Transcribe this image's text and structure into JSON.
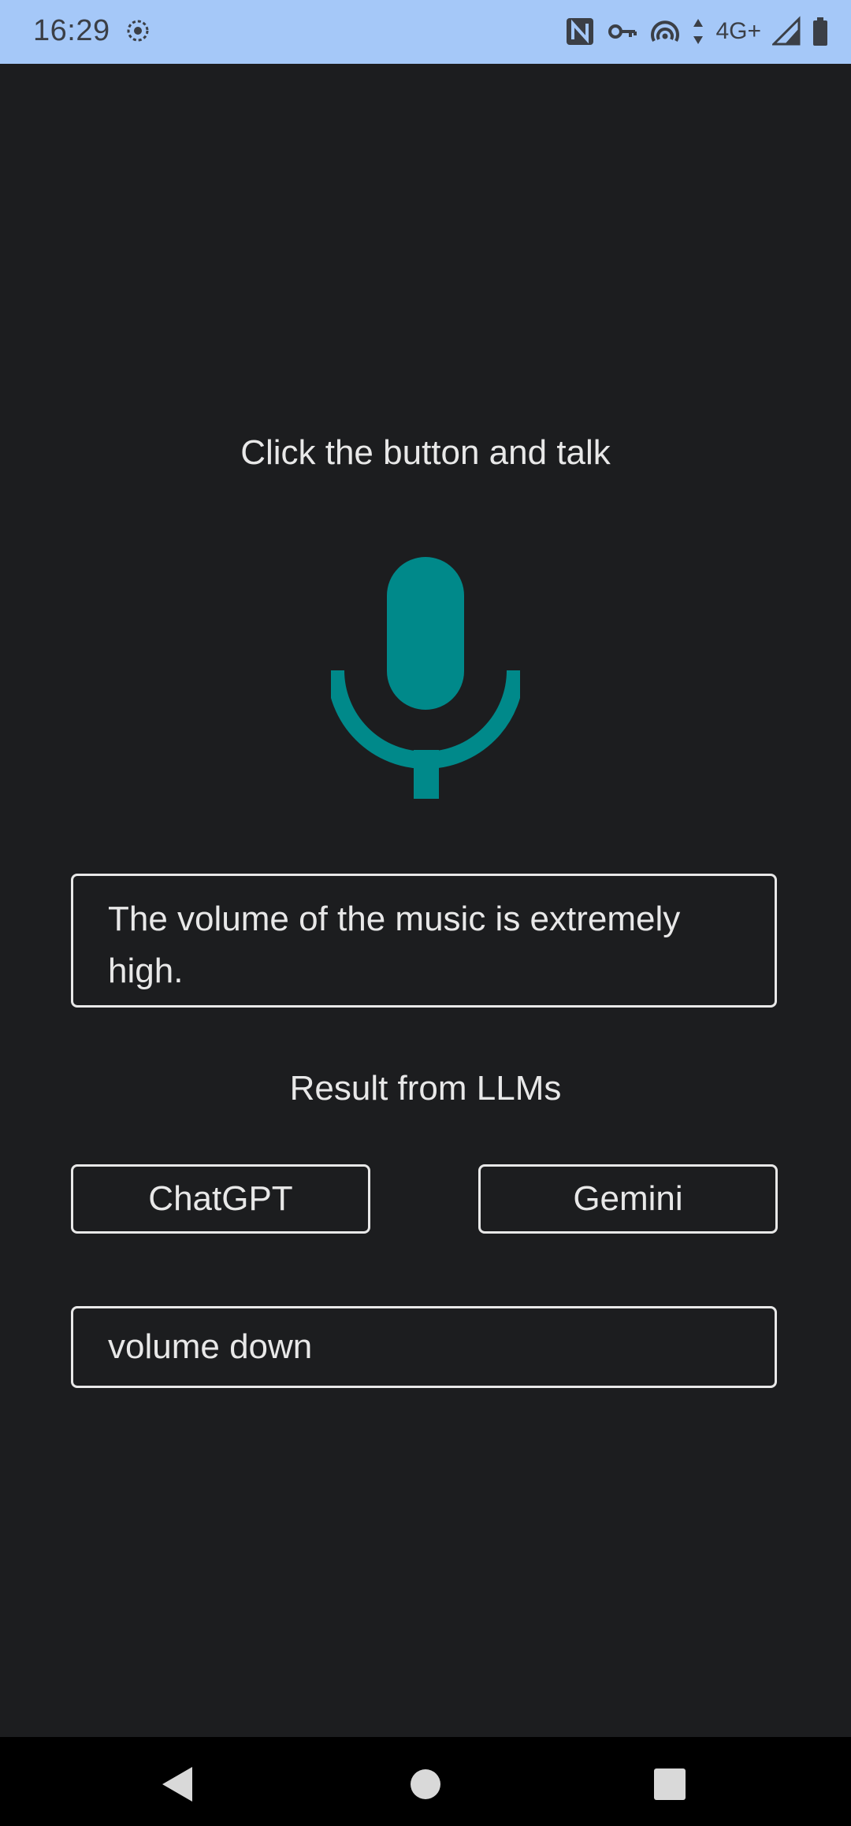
{
  "status_bar": {
    "time": "16:29",
    "network": "4G+",
    "left_icon": "location-sync-icon",
    "right_icons": [
      "nfc-icon",
      "vpn-key-icon",
      "hotspot-icon",
      "data-arrows-icon",
      "signal-icon",
      "battery-icon"
    ],
    "background_color": "#a5c8f8"
  },
  "main": {
    "prompt_text": "Click the button and talk",
    "mic_icon": "microphone-icon",
    "mic_color": "#00898a",
    "speech_text": " The volume of the music is extremely high.",
    "results_title": "Result from LLMs",
    "buttons": {
      "chatgpt": "ChatGPT",
      "gemini": "Gemini"
    },
    "result_text": "volume down"
  },
  "nav_bar": {
    "back_icon": "back-triangle-icon",
    "home_icon": "home-circle-icon",
    "recents_icon": "recents-square-icon"
  },
  "colors": {
    "background": "#1c1d1f",
    "text": "#e8e8e8",
    "accent": "#00898a"
  }
}
